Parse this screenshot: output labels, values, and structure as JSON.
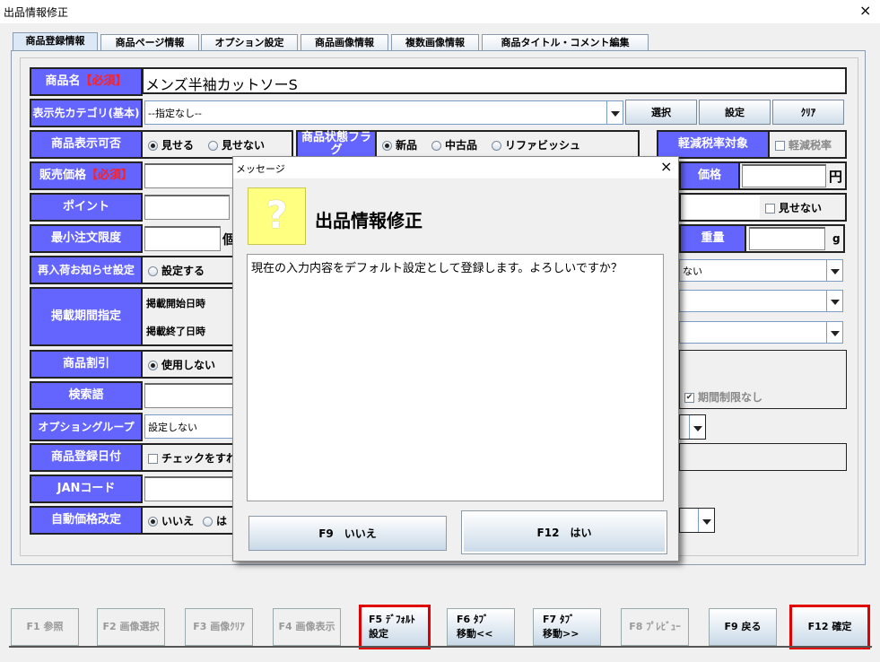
{
  "window": {
    "title": "出品情報修正",
    "close": "×"
  },
  "tabs": [
    "商品登録情報",
    "商品ページ情報",
    "オプション設定",
    "商品画像情報",
    "複数画像情報",
    "商品タイトル・コメント編集"
  ],
  "form": {
    "product_name": {
      "label": "商品名",
      "required": "【必須】",
      "value": "メンズ半袖カットソーS"
    },
    "category": {
      "label": "表示先カテゴリ(基本)",
      "value": "--指定なし--",
      "btn_select": "選択",
      "btn_set": "設定",
      "btn_clear": "ｸﾘｱ"
    },
    "visibility": {
      "label": "商品表示可否",
      "opt1": "見せる",
      "opt2": "見せない"
    },
    "condition": {
      "label": "商品状態フラグ",
      "opt1": "新品",
      "opt2": "中古品",
      "opt3": "リファビッシュ"
    },
    "tax": {
      "label": "軽減税率対象",
      "check": "軽減税率"
    },
    "price": {
      "label": "販売価格",
      "required": "【必須】",
      "label2": "価格",
      "unit": "円"
    },
    "point": {
      "label": "ポイント",
      "hide": "見せない"
    },
    "min_order": {
      "label": "最小注文限度",
      "unit": "個",
      "weight_label": "重量",
      "weight_unit": "g"
    },
    "restock": {
      "label": "再入荷お知らせ設定",
      "opt1": "設定する",
      "combo": "ない"
    },
    "period": {
      "label": "掲載期間指定",
      "start": "掲載開始日時",
      "end": "掲載終了日時"
    },
    "discount": {
      "label": "商品割引",
      "opt1": "使用しない",
      "nolimit": "期間制限なし"
    },
    "keyword": {
      "label": "検索語"
    },
    "option_group": {
      "label": "オプショングループ",
      "value": "設定しない"
    },
    "reg_date": {
      "label": "商品登録日付",
      "check": "チェックをすれば"
    },
    "jan": {
      "label": "JANコード"
    },
    "auto_price": {
      "label": "自動価格改定",
      "opt1": "いいえ",
      "opt2": "は"
    }
  },
  "dialog": {
    "title": "メッセージ",
    "close": "×",
    "icon": "?",
    "heading": "出品情報修正",
    "message": "現在の入力内容をデフォルト設定として登録します。よろしいですか？",
    "no": "F9　いいえ",
    "yes": "F12　はい"
  },
  "fkeys": [
    {
      "l1": "F1 参照",
      "l2": ""
    },
    {
      "l1": "F2 画像選択",
      "l2": ""
    },
    {
      "l1": "F3 画像ｸﾘｱ",
      "l2": ""
    },
    {
      "l1": "F4 画像表示",
      "l2": ""
    },
    {
      "l1": "F5 ﾃﾞﾌｫﾙﾄ",
      "l2": "設定"
    },
    {
      "l1": "F6 ﾀﾌﾞ",
      "l2": "移動<<"
    },
    {
      "l1": "F7 ﾀﾌﾞ",
      "l2": "移動>>"
    },
    {
      "l1": "F8 ﾌﾟﾚﾋﾞｭｰ",
      "l2": ""
    },
    {
      "l1": "F9 戻る",
      "l2": ""
    },
    {
      "l1": "F12 確定",
      "l2": ""
    }
  ]
}
